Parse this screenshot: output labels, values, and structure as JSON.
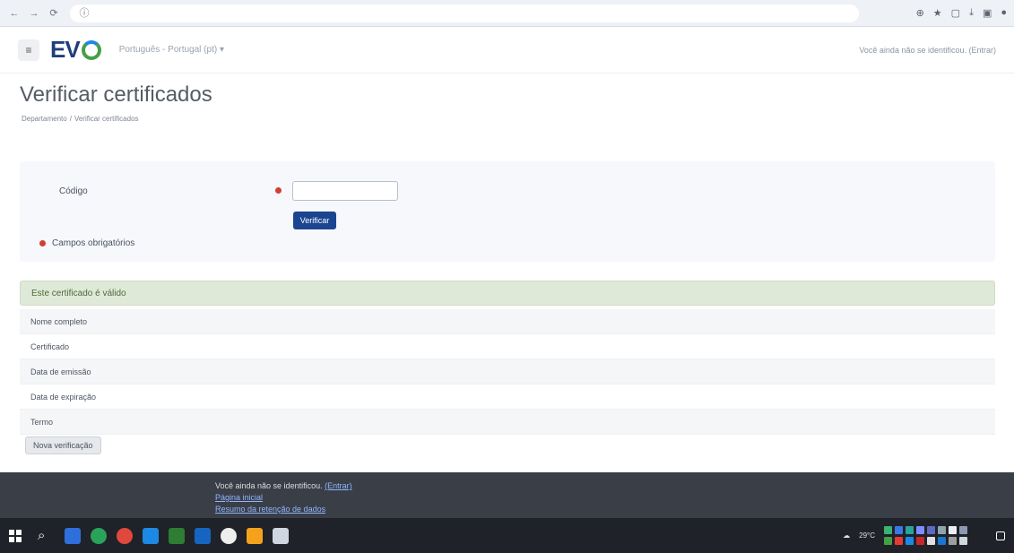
{
  "browser": {
    "back_icon": "←",
    "forward_icon": "→",
    "reload_icon": "⟳",
    "info_icon": "ⓘ",
    "url": "",
    "actions": [
      "⊕",
      "★",
      "▢",
      "⤓",
      "▣",
      "●"
    ]
  },
  "header": {
    "logo": "EV",
    "language": "Português - Portugal (pt) ▾",
    "user": "Você ainda não se identificou. (Entrar)"
  },
  "page": {
    "title": "Verificar certificados",
    "breadcrumb": [
      "Departamento",
      "Verificar certificados"
    ]
  },
  "form": {
    "code_label": "Código",
    "code_value": "",
    "verify_label": "Verificar",
    "required_note": "Campos obrigatórios"
  },
  "result": {
    "banner": "Este certificado é válido",
    "rows": [
      {
        "label": "Nome completo",
        "value": ""
      },
      {
        "label": "Certificado",
        "value": ""
      },
      {
        "label": "Data de emissão",
        "value": ""
      },
      {
        "label": "Data de expiração",
        "value": ""
      },
      {
        "label": "Termo",
        "value": ""
      }
    ],
    "new_verify_label": "Nova verificação"
  },
  "footer": {
    "line1_text": "Você ainda não se identificou.",
    "line1_link": "(Entrar)",
    "line2": "Página inicial",
    "line3": "Resumo da retenção de dados"
  },
  "taskbar": {
    "search_icon": "⌕",
    "tray_temp": "29°C",
    "clock_time": "",
    "clock_date": ""
  },
  "colors": {
    "primary_button": "#1b4591",
    "success_bg": "#dfe9d8",
    "required": "#d23f31",
    "footer_bg": "#3a3e47",
    "taskbar_bg": "#1f2228"
  }
}
